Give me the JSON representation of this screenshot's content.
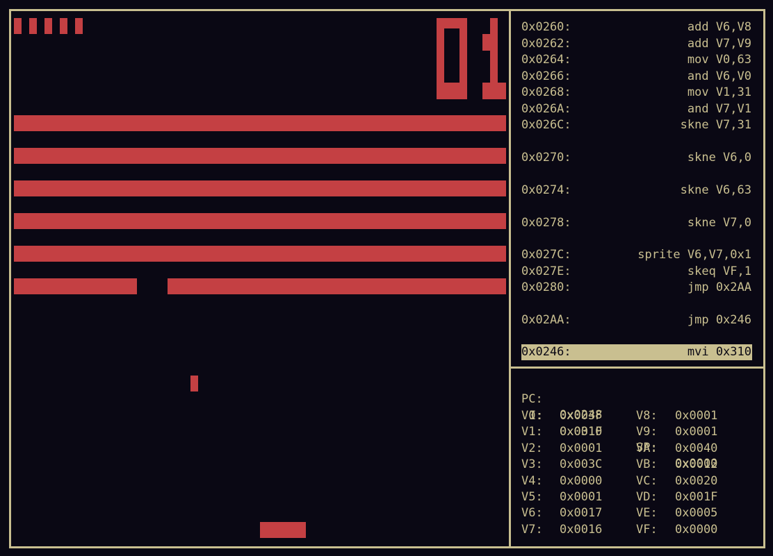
{
  "colors": {
    "background": "#0a0814",
    "foreground": "#c9bf90",
    "pixel": "#c44043"
  },
  "game": {
    "score": "01",
    "lives": 5,
    "brick_rows": 6,
    "missing_brick": "row 6, bricks 9-10 of 32",
    "ball": "visible",
    "paddle": "visible"
  },
  "disassembly": [
    {
      "addr": "0x0260:",
      "instr": "add V6,V8"
    },
    {
      "addr": "0x0262:",
      "instr": "add V7,V9"
    },
    {
      "addr": "0x0264:",
      "instr": "mov V0,63"
    },
    {
      "addr": "0x0266:",
      "instr": "and V6,V0"
    },
    {
      "addr": "0x0268:",
      "instr": "mov V1,31"
    },
    {
      "addr": "0x026A:",
      "instr": "and V7,V1"
    },
    {
      "addr": "0x026C:",
      "instr": "skne V7,31"
    },
    {
      "addr": "0x0270:",
      "instr": "skne V6,0"
    },
    {
      "addr": "0x0274:",
      "instr": "skne V6,63"
    },
    {
      "addr": "0x0278:",
      "instr": "skne V7,0"
    },
    {
      "addr": "0x027C:",
      "instr": "sprite V6,V7,0x1"
    },
    {
      "addr": "0x027E:",
      "instr": "skeq VF,1"
    },
    {
      "addr": "0x0280:",
      "instr": "jmp 0x2AA"
    },
    {
      "addr": "0x02AA:",
      "instr": "jmp 0x246"
    },
    {
      "addr": "0x0246:",
      "instr": "mvi 0x310"
    }
  ],
  "registers": {
    "pc": {
      "name": "PC:",
      "value": "0x0248"
    },
    "i": {
      "name": "I:",
      "value": "0x0310"
    },
    "sp": {
      "name": "SP:",
      "value": "0x0000"
    },
    "left": [
      {
        "name": "V0:",
        "value": "0x003F"
      },
      {
        "name": "V1:",
        "value": "0x001F"
      },
      {
        "name": "V2:",
        "value": "0x0001"
      },
      {
        "name": "V3:",
        "value": "0x003C"
      },
      {
        "name": "V4:",
        "value": "0x0000"
      },
      {
        "name": "V5:",
        "value": "0x0001"
      },
      {
        "name": "V6:",
        "value": "0x0017"
      },
      {
        "name": "V7:",
        "value": "0x0016"
      }
    ],
    "right": [
      {
        "name": "V8:",
        "value": "0x0001"
      },
      {
        "name": "V9:",
        "value": "0x0001"
      },
      {
        "name": "VA:",
        "value": "0x0040"
      },
      {
        "name": "VB:",
        "value": "0x0012"
      },
      {
        "name": "VC:",
        "value": "0x0020"
      },
      {
        "name": "VD:",
        "value": "0x001F"
      },
      {
        "name": "VE:",
        "value": "0x0005"
      },
      {
        "name": "VF:",
        "value": "0x0000"
      }
    ]
  }
}
